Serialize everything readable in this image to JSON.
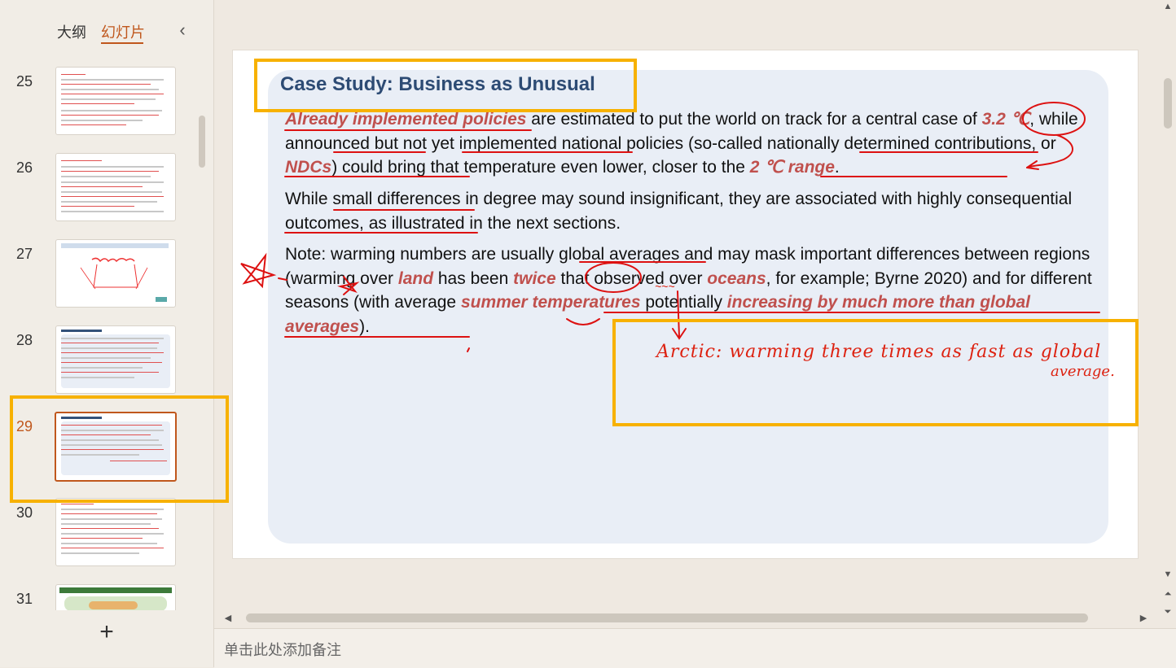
{
  "sidebar": {
    "tabs": {
      "outline": "大纲",
      "slides": "幻灯片"
    },
    "collapse_icon": "‹",
    "add_icon": "+",
    "slide_numbers": [
      "25",
      "26",
      "27",
      "28",
      "29",
      "30",
      "31"
    ],
    "active_slide": "29"
  },
  "slide": {
    "title": "Case Study: Business as Unusual",
    "p1": {
      "em1": "Already implemented policies",
      "t1": " are estimated to put the world on track for a central case of ",
      "em2": "3.2 ℃",
      "t2": ", while announced but not yet implemented national policies (so-called nationally determined contributions, or ",
      "em3": "NDCs",
      "t3": ") could bring that temperature even lower, closer to the ",
      "em4": "2 ℃ range",
      "t4": "."
    },
    "p2": "While small differences in degree may sound insignificant, they are associated with highly consequential outcomes, as illustrated in the next sections.",
    "p3": {
      "t1": "Note: warming numbers are usually global averages and may mask important differences between regions (warming over ",
      "em1": "land",
      "t2": " has been ",
      "em2": "twice",
      "t3": " that observed over ",
      "em3": "oceans",
      "t4": ", for example; Byrne 2020) and for different seasons (with average ",
      "em4": "summer temperatures",
      "t5": " potentially ",
      "em5": "increasing by much more than global averages",
      "t6": ")."
    },
    "annotation": {
      "line1": "Arctic:  warming  three  times   as  fast   as  global",
      "line2": "average."
    }
  },
  "notes": {
    "placeholder": "单击此处添加备注"
  },
  "colors": {
    "accent": "#c0571c",
    "highlight": "#f7b100",
    "ink": "#dd1111",
    "title": "#2d4b74",
    "emphasis": "#c0504d"
  }
}
